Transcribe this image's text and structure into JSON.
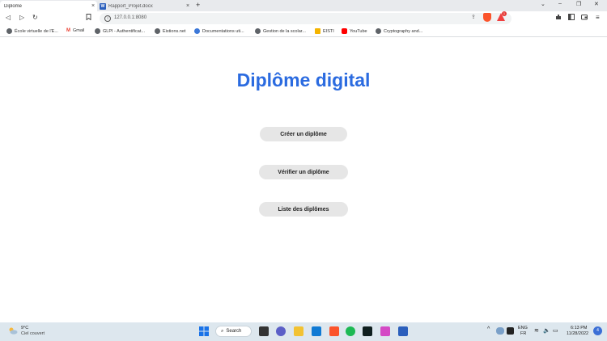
{
  "browser": {
    "tabs": [
      {
        "title": "Diplome",
        "active": true
      },
      {
        "title": "Rapport_Projet.docx",
        "active": false
      }
    ],
    "new_tab_symbol": "+",
    "close_symbol": "×",
    "window_controls": [
      "⌄",
      "–",
      "❐",
      "✕"
    ],
    "nav": {
      "back": "◁",
      "forward": "▷",
      "reload": "↻",
      "bookmark": "🔖"
    },
    "url": "127.0.0.1:8080",
    "shield_badge": "1",
    "bookmarks": [
      {
        "label": "École virtuelle de l'E...",
        "color": "#5f6368"
      },
      {
        "label": "Gmail",
        "color": "#ea4335"
      },
      {
        "label": "GLPI - Authentificat...",
        "color": "#5f6368"
      },
      {
        "label": "Eistions.net",
        "color": "#5f6368"
      },
      {
        "label": "Documentations uti...",
        "color": "#3c78d8"
      },
      {
        "label": "Gestion de la scolar...",
        "color": "#5f6368"
      },
      {
        "label": "EISTI",
        "color": "#f4b400"
      },
      {
        "label": "YouTube",
        "color": "#ff0000"
      },
      {
        "label": "Cryptography and...",
        "color": "#5f6368"
      }
    ]
  },
  "page": {
    "title": "Diplôme digital",
    "buttons": {
      "create": "Créer un diplôme",
      "verify": "Vérifier un diplôme",
      "list": "Liste des diplômes"
    }
  },
  "taskbar": {
    "weather_temp": "9°C",
    "weather_desc": "Ciel couvert",
    "search_label": "Search",
    "tray_arrow": "^",
    "lang_top": "ENG",
    "lang_bottom": "FR",
    "time": "6:13 PM",
    "date": "11/28/2022",
    "notification_count": "4"
  },
  "colors": {
    "title": "#2b6be0",
    "button_bg": "#e6e6e6",
    "taskbar_bg": "#dde7ee"
  }
}
